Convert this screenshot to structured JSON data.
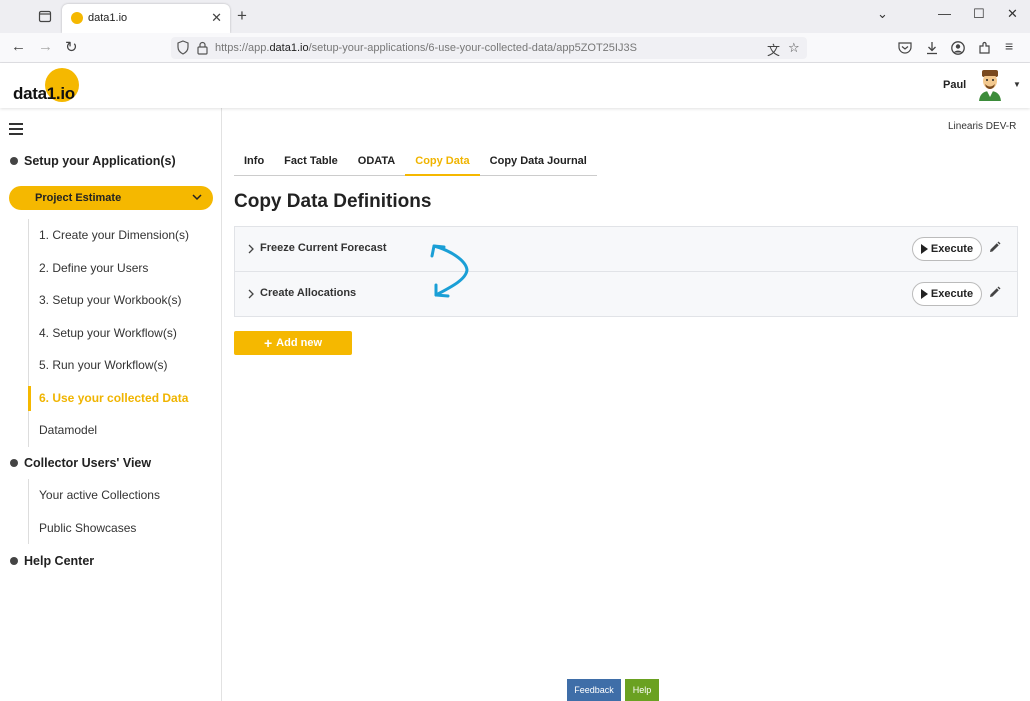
{
  "browser": {
    "tab_title": "data1.io",
    "url_prefix": "https://app.",
    "url_domain": "data1.io",
    "url_path": "/setup-your-applications/6-use-your-collected-data/app5ZOT25IJ3S"
  },
  "header": {
    "logo_text": "data1.io",
    "user_name": "Paul"
  },
  "sidebar": {
    "sections": [
      {
        "label": "Setup your Application(s)"
      },
      {
        "label": "Collector Users' View"
      },
      {
        "label": "Help Center"
      }
    ],
    "project_select": "Project Estimate",
    "setup_items": [
      {
        "label": "1. Create your Dimension(s)"
      },
      {
        "label": "2. Define your Users"
      },
      {
        "label": "3. Setup your Workbook(s)"
      },
      {
        "label": "4. Setup your Workflow(s)"
      },
      {
        "label": "5. Run your Workflow(s)"
      },
      {
        "label": "6. Use your collected Data"
      },
      {
        "label": "Datamodel"
      }
    ],
    "collector_items": [
      {
        "label": "Your active Collections"
      },
      {
        "label": "Public Showcases"
      }
    ]
  },
  "main": {
    "tenant": "Linearis DEV-R",
    "tabs": [
      {
        "label": "Info"
      },
      {
        "label": "Fact Table"
      },
      {
        "label": "ODATA"
      },
      {
        "label": "Copy Data"
      },
      {
        "label": "Copy Data Journal"
      }
    ],
    "title": "Copy Data Definitions",
    "definitions": [
      {
        "name": "Freeze Current Forecast",
        "action": "Execute"
      },
      {
        "name": "Create Allocations",
        "action": "Execute"
      }
    ],
    "add_label": "Add new"
  },
  "footer": {
    "feedback": "Feedback",
    "help": "Help"
  },
  "colors": {
    "accent": "#f5b800",
    "feedback": "#3f6ea8",
    "help": "#6aa121",
    "annotation": "#1a9fd6"
  }
}
